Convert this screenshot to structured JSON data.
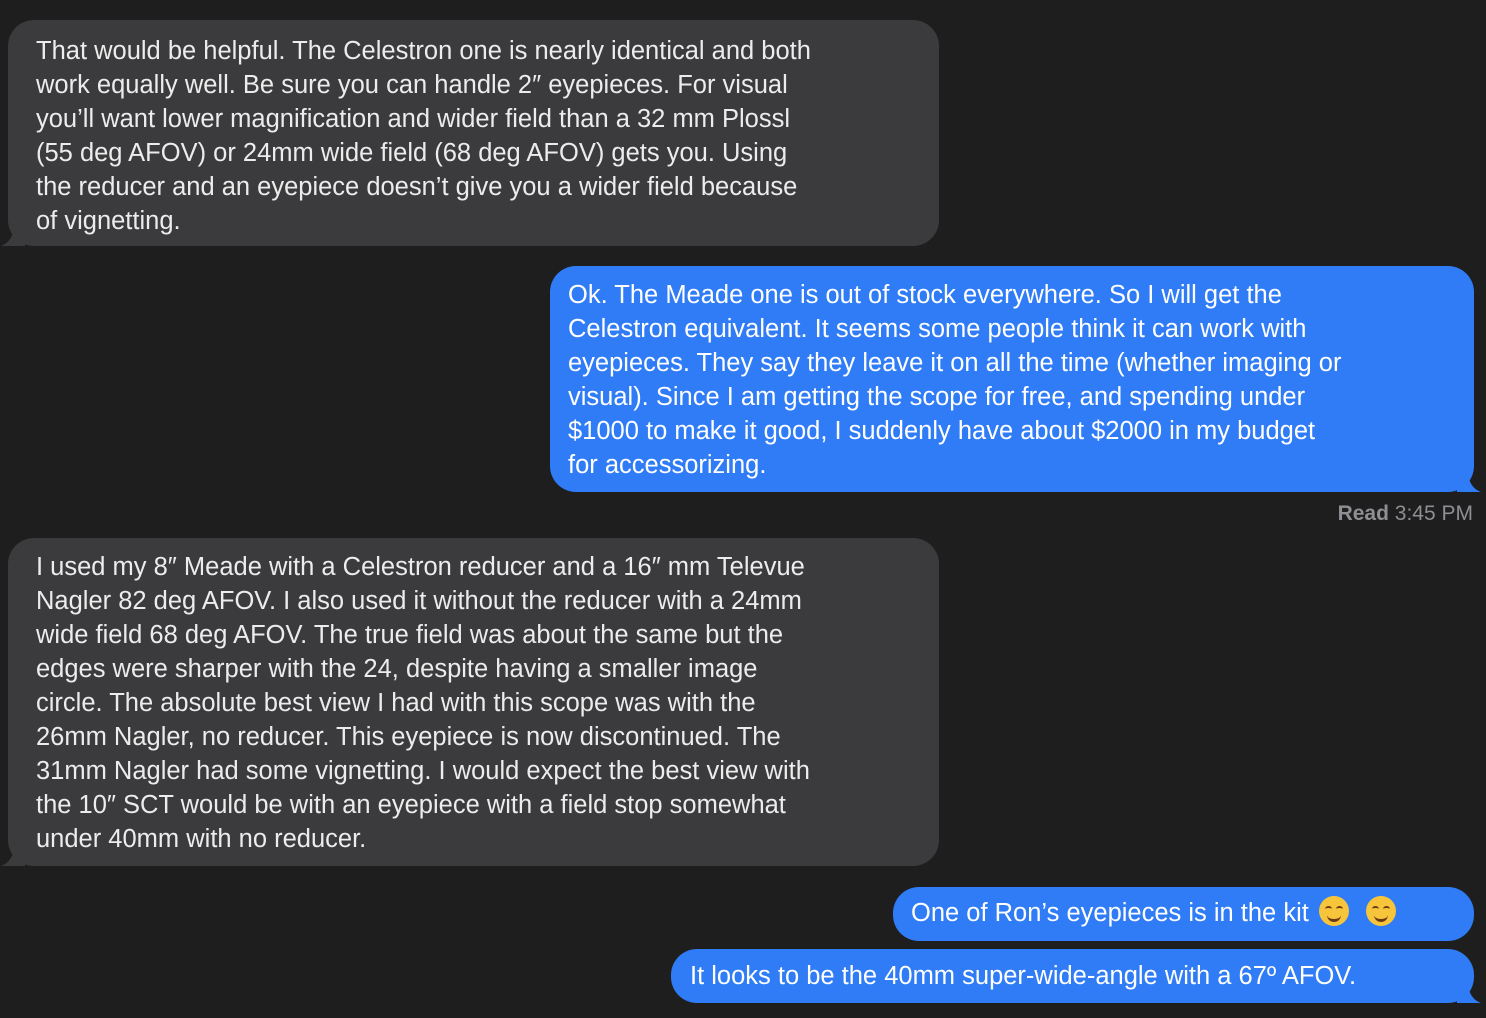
{
  "messages": [
    {
      "direction": "incoming",
      "lines": [
        "That would be helpful. The Celestron one is nearly identical and both",
        "work equally well. Be sure you can handle 2″ eyepieces. For visual",
        "you’ll want lower magnification and wider field than a 32 mm Plossl",
        "(55 deg AFOV) or 24mm wide field (68 deg AFOV) gets you. Using",
        "the reducer and an eyepiece doesn’t give you a wider field because",
        "of vignetting."
      ]
    },
    {
      "direction": "outgoing",
      "lines": [
        "Ok. The Meade one is out of stock everywhere. So I will get the",
        "Celestron equivalent. It seems some people think it can work with",
        "eyepieces. They say they leave it on all the time (whether imaging or",
        "visual). Since I am getting the scope for free, and spending under",
        "$1000 to make it good, I suddenly have about $2000 in my budget",
        "for accessorizing."
      ]
    },
    {
      "direction": "incoming",
      "lines": [
        "I used my 8″ Meade with a Celestron reducer and a 16″ mm Televue",
        "Nagler 82 deg AFOV. I also used it without the reducer with a 24mm",
        "wide field 68 deg AFOV. The true field was about the same but the",
        "edges were sharper with the 24, despite having a smaller image",
        "circle. The absolute best view I had with this scope was with the",
        "26mm Nagler, no reducer. This eyepiece is now discontinued. The",
        "31mm Nagler had some vignetting. I would expect the best view with",
        "the 10″ SCT would be with an eyepiece with a field stop somewhat",
        "under 40mm with no reducer."
      ]
    },
    {
      "direction": "outgoing",
      "text": "One of Ron’s eyepieces is in the kit",
      "emoji": [
        "smiling-face-emoji",
        "smiling-face-emoji"
      ]
    },
    {
      "direction": "outgoing",
      "text": "It looks to be the 40mm super-wide-angle with a 67º AFOV."
    }
  ],
  "read_receipt": {
    "label": "Read",
    "time": "3:45 PM"
  },
  "colors": {
    "background": "#1e1e1e",
    "incoming_bubble": "#3b3b3d",
    "outgoing_bubble": "#2f7cf6"
  }
}
